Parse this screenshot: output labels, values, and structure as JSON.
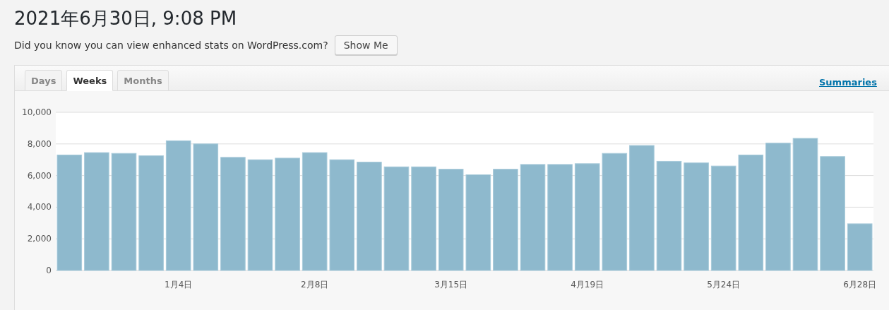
{
  "heading": "2021年6月30日, 9:08 PM",
  "notice": {
    "text": "Did you know you can view enhanced stats on WordPress.com?",
    "button": "Show Me"
  },
  "tabs": [
    {
      "label": "Days",
      "selected": false
    },
    {
      "label": "Weeks",
      "selected": true
    },
    {
      "label": "Months",
      "selected": false
    }
  ],
  "summaries_link": "Summaries",
  "chart_data": {
    "type": "bar",
    "categories": [
      null,
      null,
      null,
      null,
      "1月4日",
      null,
      null,
      null,
      null,
      "2月8日",
      null,
      null,
      null,
      null,
      "3月15日",
      null,
      null,
      null,
      null,
      "4月19日",
      null,
      null,
      null,
      null,
      "5月24日",
      null,
      null,
      null,
      null,
      "6月28日"
    ],
    "series": [
      {
        "color": "#8eb9cd",
        "values": [
          7300,
          7450,
          7400,
          7250,
          8200,
          8000,
          7150,
          7000,
          7100,
          7450,
          7000,
          6850,
          6550,
          6550,
          6400,
          6050,
          6400,
          6700,
          6700,
          6750,
          7400,
          7900,
          6900,
          6800,
          6600,
          7300,
          8050,
          8350,
          7200,
          2950
        ]
      }
    ],
    "ylim": [
      0,
      10000
    ],
    "grid": true,
    "yticks": [
      {
        "value": 0,
        "label": "0"
      },
      {
        "value": 2000,
        "label": "2,000"
      },
      {
        "value": 4000,
        "label": "4,000"
      },
      {
        "value": 6000,
        "label": "6,000"
      },
      {
        "value": 8000,
        "label": "8,000"
      },
      {
        "value": 10000,
        "label": "10,000"
      }
    ]
  }
}
